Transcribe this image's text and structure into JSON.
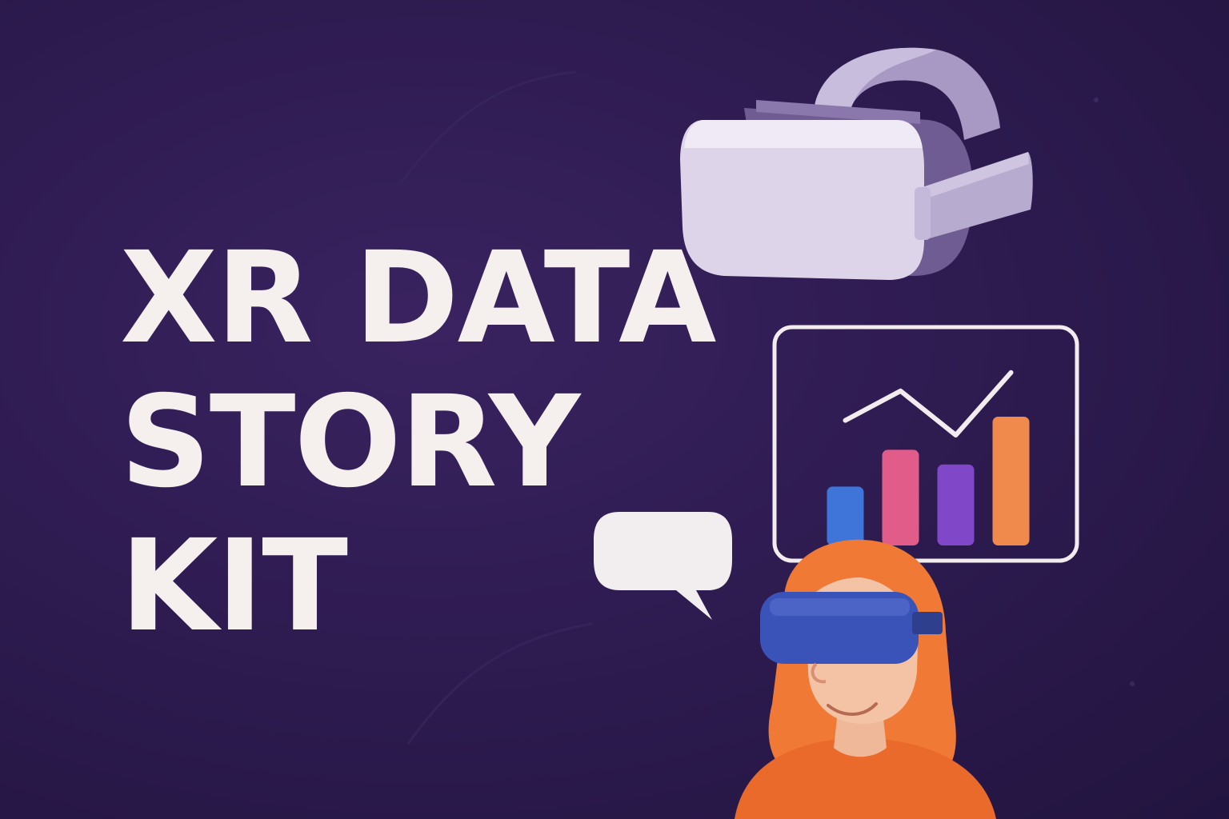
{
  "title": {
    "line1": "XR DATA",
    "line2": "STORY",
    "line3": "KIT"
  },
  "colors": {
    "background": "#2c1a4e",
    "title_text": "#f5efee",
    "headset": "#ddd4ea",
    "chart_frame": "#f2ecef",
    "bar_blue": "#3f74d8",
    "bar_pink": "#e25c8a",
    "bar_purple": "#8048c8",
    "bar_orange": "#f08a4c",
    "hair": "#f07a35",
    "skin": "#f4c3a6",
    "goggles": "#3a53b8"
  },
  "chart_data": {
    "type": "bar",
    "categories": [
      "",
      "",
      "",
      ""
    ],
    "values": [
      1.6,
      2.6,
      2.2,
      3.5
    ],
    "overlay_line": [
      3.4,
      4.2,
      3.0,
      4.7
    ],
    "ylim": [
      0,
      5
    ],
    "bar_colors": [
      "#3f74d8",
      "#e25c8a",
      "#8048c8",
      "#f08a4c"
    ]
  },
  "icons": [
    "vr-headset-icon",
    "chart-icon",
    "speech-bubble-icon",
    "person-with-vr-icon"
  ]
}
